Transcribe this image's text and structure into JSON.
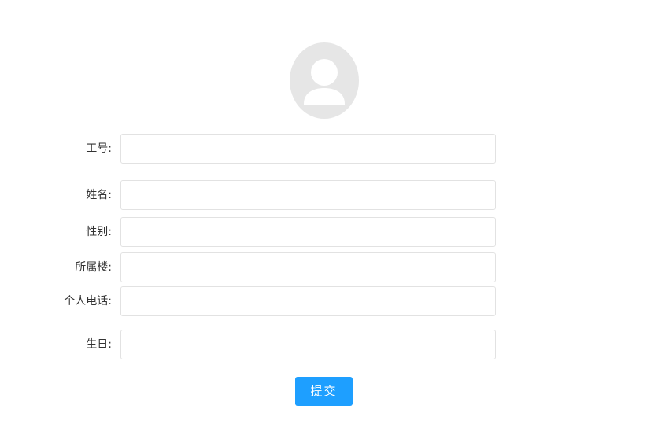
{
  "form": {
    "fields": [
      {
        "label": "工号:",
        "value": ""
      },
      {
        "label": "姓名:",
        "value": ""
      },
      {
        "label": "性别:",
        "value": ""
      },
      {
        "label": "所属楼:",
        "value": ""
      },
      {
        "label": "个人电话:",
        "value": ""
      },
      {
        "label": "生日:",
        "value": ""
      }
    ],
    "submit_label": "提交"
  },
  "icons": {
    "avatar": "user-avatar-icon"
  },
  "colors": {
    "primary_button": "#1e9fff",
    "avatar_bg": "#e6e6e6",
    "input_border": "#e2e2e2"
  }
}
